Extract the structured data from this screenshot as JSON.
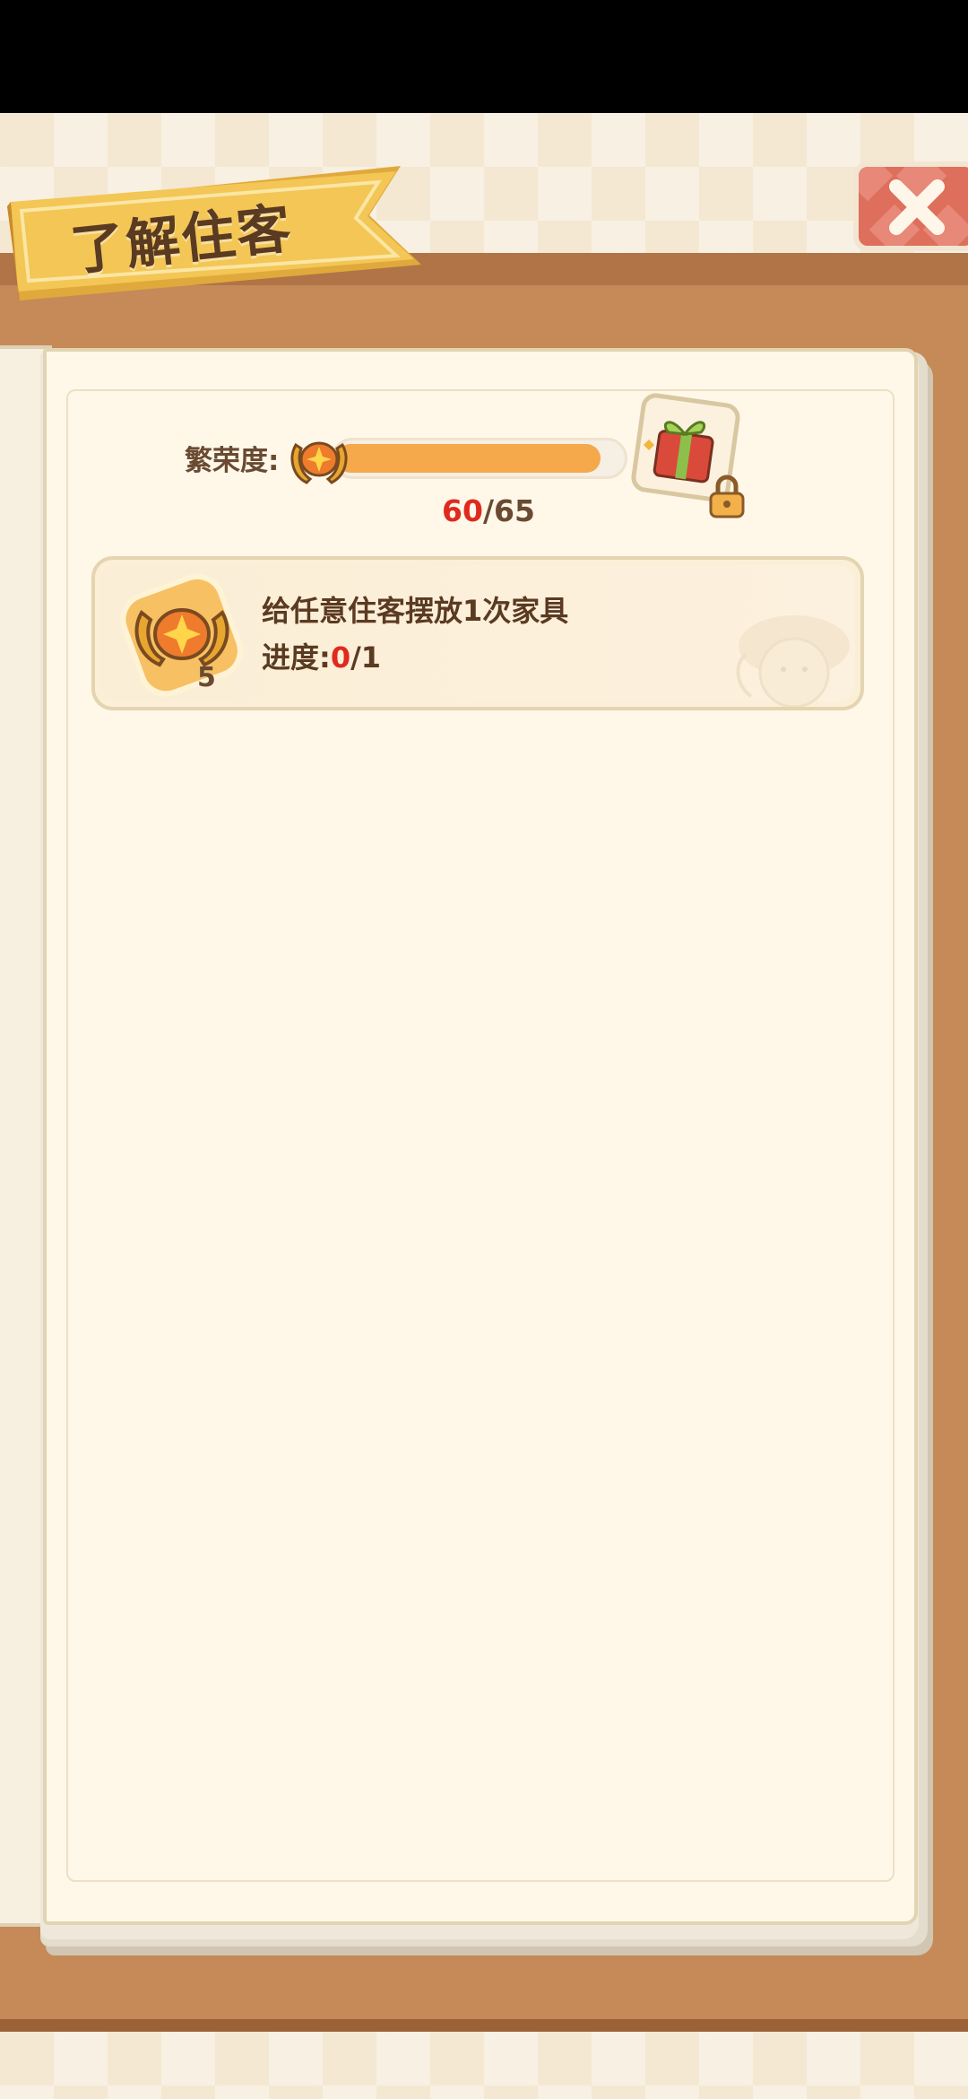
{
  "header": {
    "title": "了解住客"
  },
  "prosperity": {
    "label": "繁荣度:",
    "current": "60",
    "separator": "/",
    "max": "65",
    "fill_fraction": 0.923,
    "reward_icon": "gift-box-icon",
    "reward_locked": true
  },
  "tasks": [
    {
      "title": "给任意住客摆放1次家具",
      "progress_label": "进度:",
      "progress_current": "0",
      "progress_separator": "/",
      "progress_total": "1",
      "reward_icon": "prosperity-medal-icon",
      "reward_amount": "5"
    }
  ],
  "colors": {
    "board": "#c58a58",
    "page": "#fff8e9",
    "progress_fill": "#f5a94b",
    "highlight_red": "#e02a1e",
    "close_button": "#de6f5d",
    "banner": "#f0c04f"
  }
}
